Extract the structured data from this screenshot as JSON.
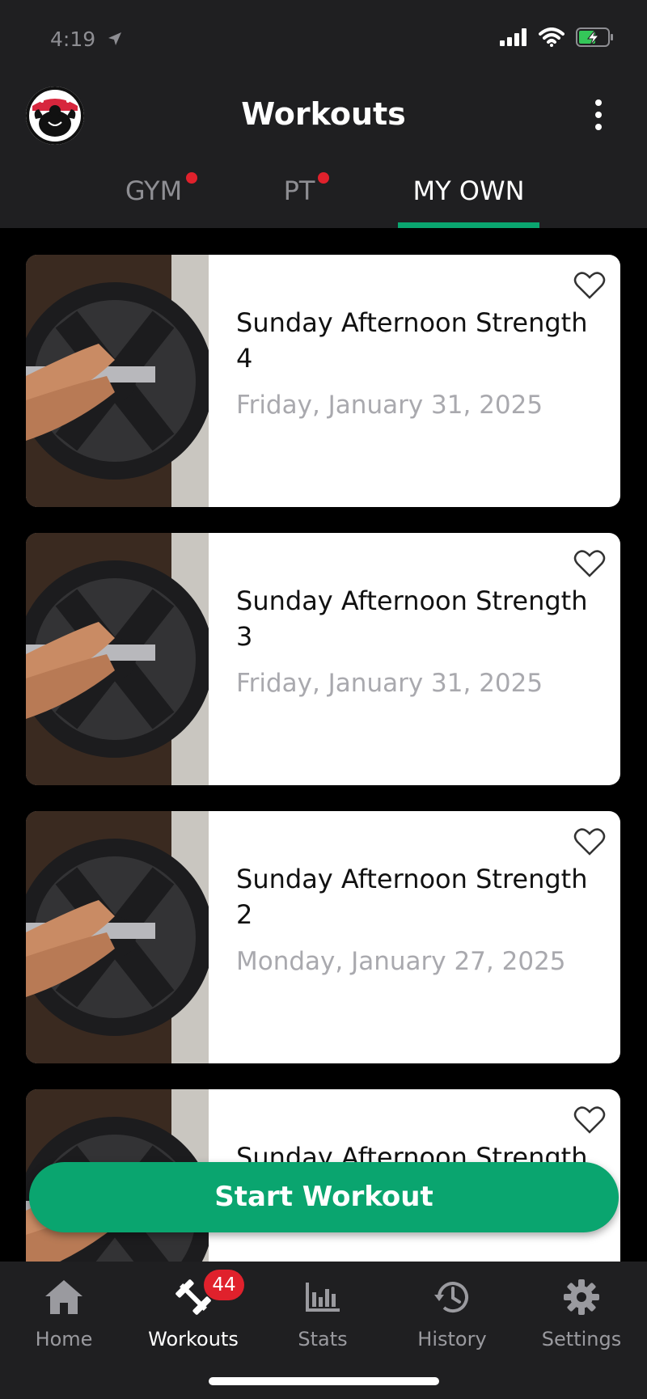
{
  "status_bar": {
    "time": "4:19"
  },
  "header": {
    "title": "Workouts",
    "logo_icon": "bodybuilder-logo-icon",
    "menu_icon": "more-vertical-icon"
  },
  "tabs": [
    {
      "label": "GYM",
      "has_dot": true,
      "active": false
    },
    {
      "label": "PT",
      "has_dot": true,
      "active": false
    },
    {
      "label": "MY OWN",
      "has_dot": false,
      "active": true
    }
  ],
  "workouts": [
    {
      "title": "Sunday Afternoon Strength 4",
      "date": "Friday, January 31, 2025"
    },
    {
      "title": "Sunday Afternoon Strength 3",
      "date": "Friday, January 31, 2025"
    },
    {
      "title": "Sunday Afternoon Strength 2",
      "date": "Monday, January 27, 2025"
    },
    {
      "title": "Sunday Afternoon Strength",
      "date": ""
    }
  ],
  "start_button": {
    "label": "Start Workout"
  },
  "bottom_nav": [
    {
      "label": "Home",
      "icon": "home-icon",
      "active": false
    },
    {
      "label": "Workouts",
      "icon": "dumbbell-icon",
      "active": true,
      "badge": "44"
    },
    {
      "label": "Stats",
      "icon": "bar-chart-icon",
      "active": false
    },
    {
      "label": "History",
      "icon": "history-icon",
      "active": false
    },
    {
      "label": "Settings",
      "icon": "gear-icon",
      "active": false
    }
  ],
  "colors": {
    "accent": "#0aa56f",
    "badge": "#e0212c",
    "bar_bg": "#1f1f21"
  }
}
